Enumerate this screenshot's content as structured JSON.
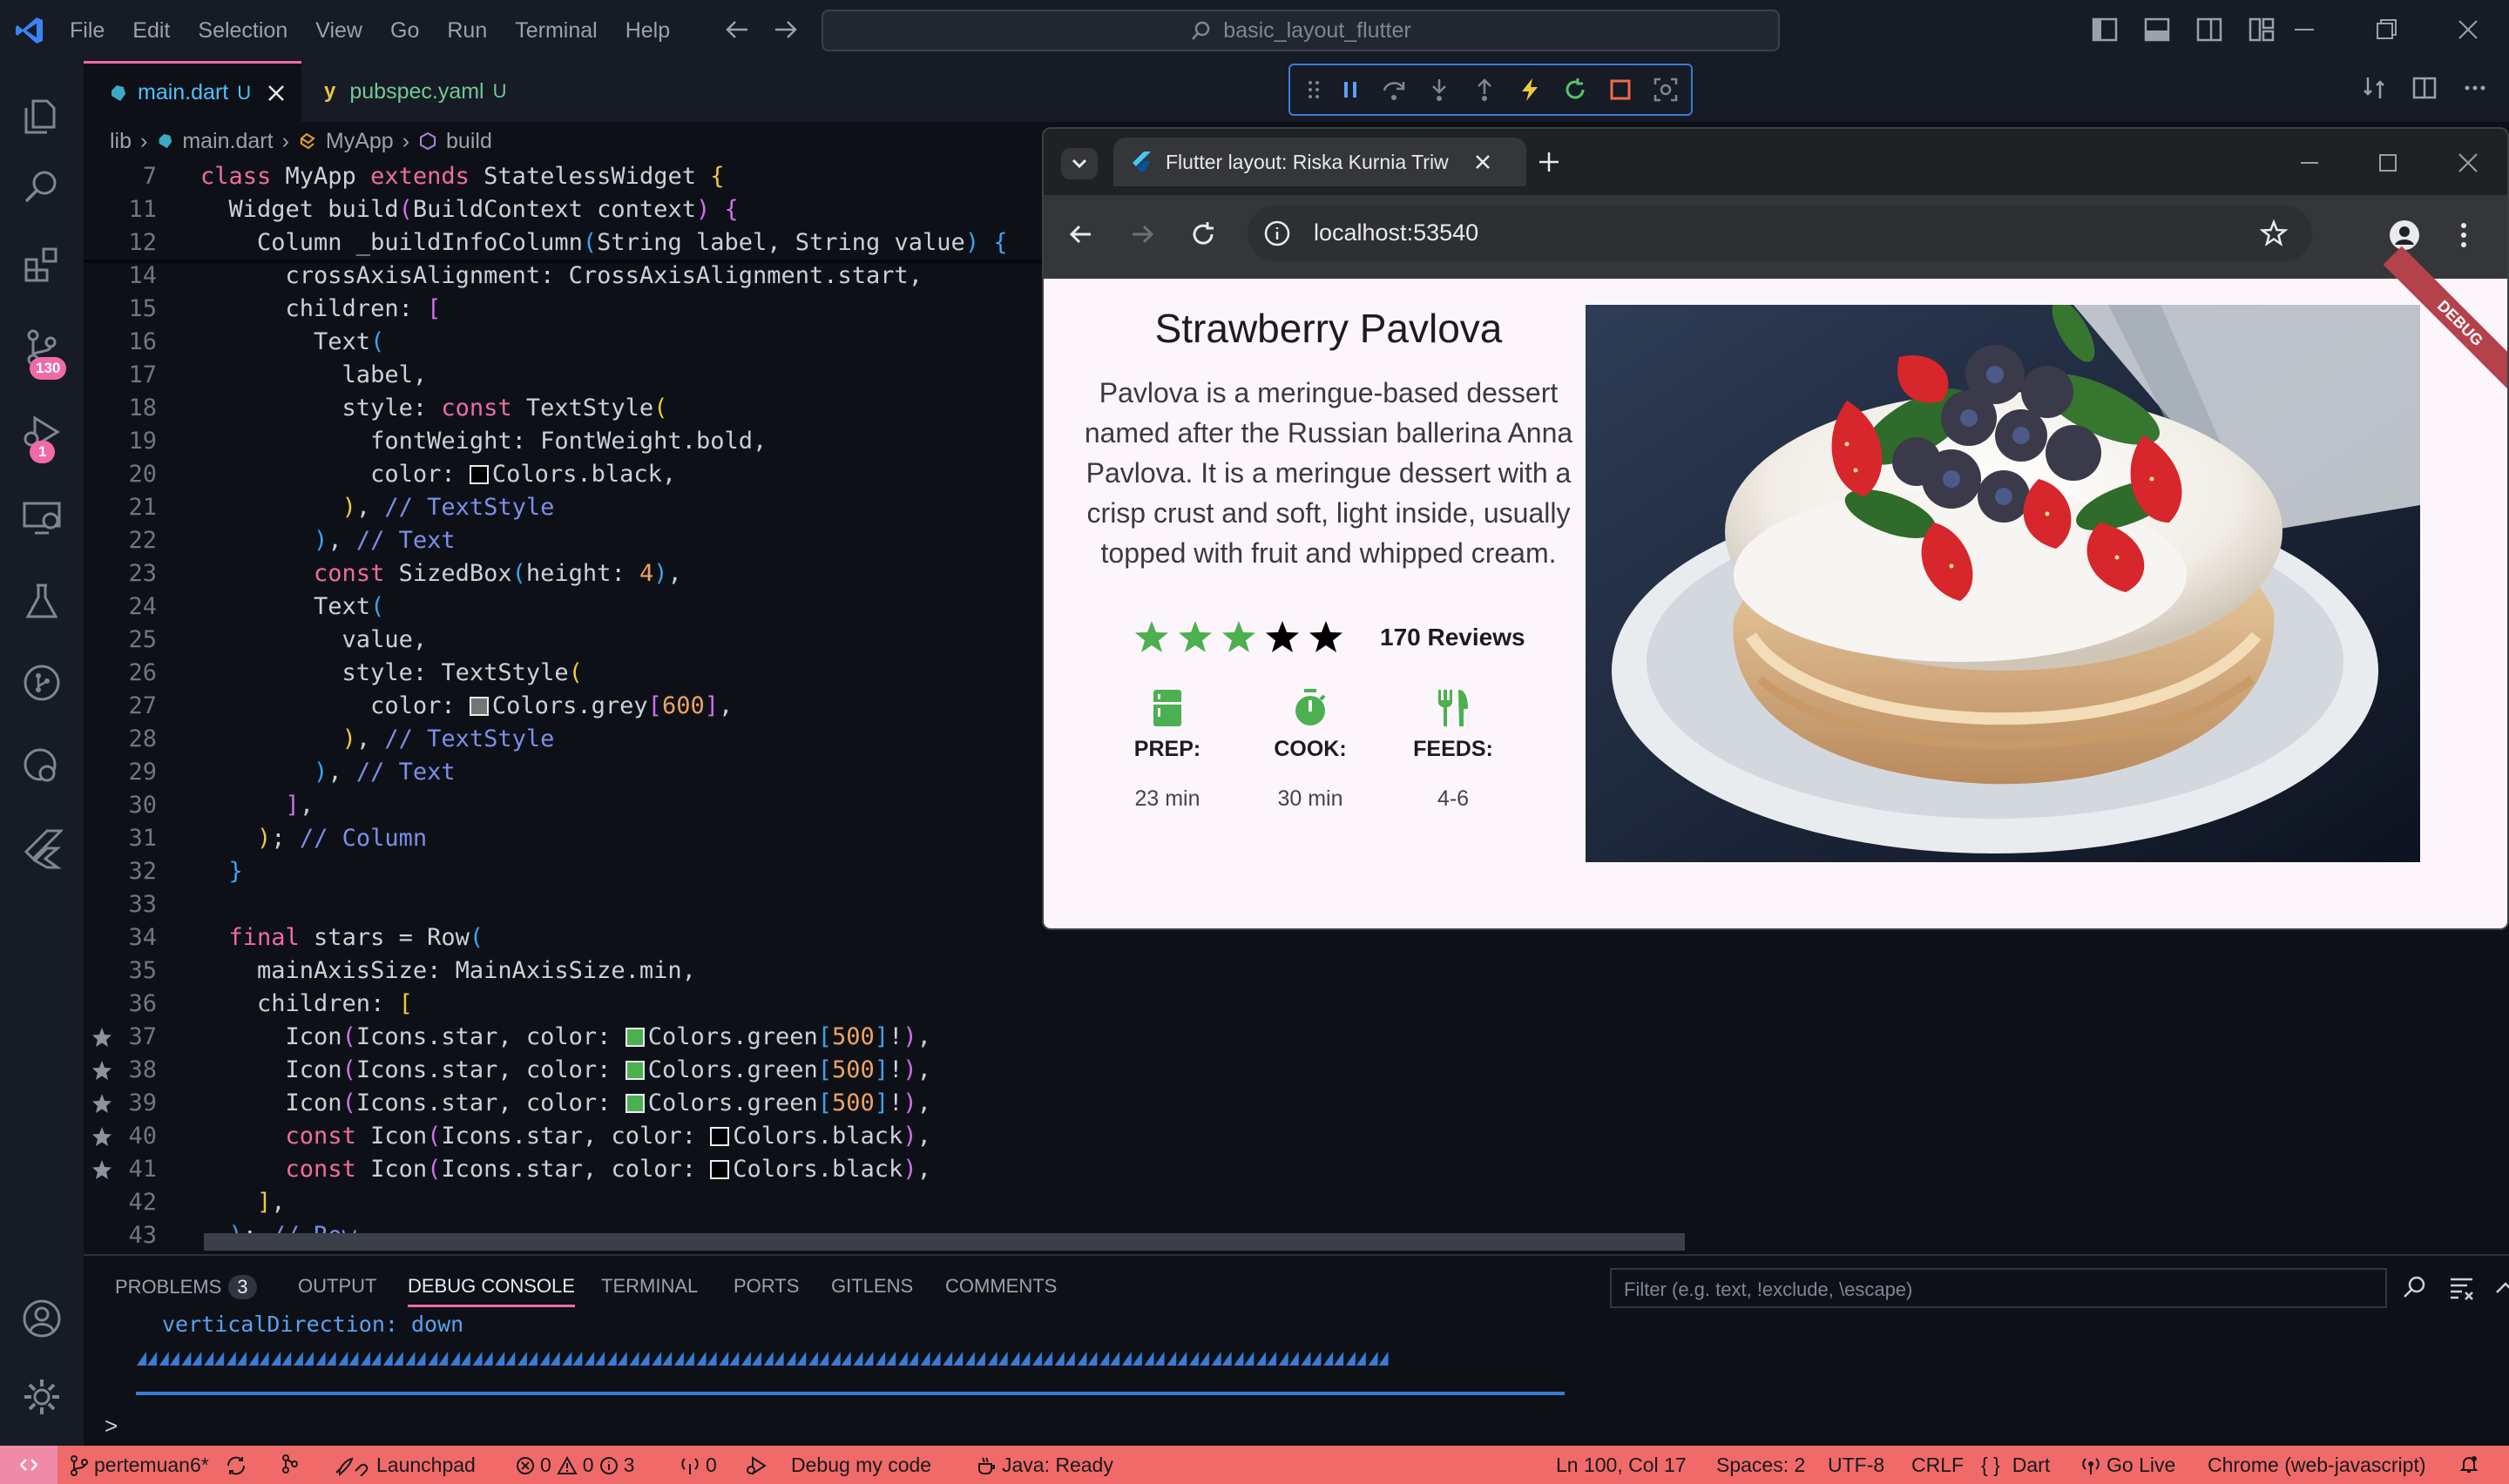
{
  "titlebar": {
    "menu": [
      "File",
      "Edit",
      "Selection",
      "View",
      "Go",
      "Run",
      "Terminal",
      "Help"
    ],
    "search_text": "basic_layout_flutter"
  },
  "activity": {
    "badges": {
      "scm": "130",
      "debug": "1"
    }
  },
  "tabs": [
    {
      "label": "main.dart",
      "status": "U",
      "active": true
    },
    {
      "label": "pubspec.yaml",
      "status": "U",
      "active": false
    }
  ],
  "breadcrumb": [
    "lib",
    "main.dart",
    "MyApp",
    "build"
  ],
  "editor": {
    "lines": [
      {
        "n": "7",
        "html": "<span class='kw'>class</span> MyApp <span class='kw'>extends</span> StatelessWidget <span class='br1'>{</span>"
      },
      {
        "n": "11",
        "html": "  Widget build<span class='br2'>(</span>BuildContext context<span class='br2'>)</span> <span class='br2'>{</span>"
      },
      {
        "n": "12",
        "html": "    Column _buildInfoColumn<span class='br3'>(</span>String label, String value<span class='br3'>)</span> <span class='br3'>{</span>"
      },
      {
        "n": "14",
        "html": "      crossAxisAlignment: CrossAxisAlignment.start,"
      },
      {
        "n": "15",
        "html": "      children: <span class='br2'>[</span>"
      },
      {
        "n": "16",
        "html": "        Text<span class='br3'>(</span>"
      },
      {
        "n": "17",
        "html": "          label,"
      },
      {
        "n": "18",
        "html": "          style: <span class='kw'>const</span> TextStyle<span class='br1'>(</span>"
      },
      {
        "n": "19",
        "html": "            fontWeight: FontWeight.bold,"
      },
      {
        "n": "20",
        "html": "            color: <span class='swatch' style='background:#000'></span>Colors.black,"
      },
      {
        "n": "21",
        "html": "          <span class='br1'>)</span>, <span class='cm'>// TextStyle</span>"
      },
      {
        "n": "22",
        "html": "        <span class='br3'>)</span>, <span class='cm'>// Text</span>"
      },
      {
        "n": "23",
        "html": "        <span class='kw'>const</span> SizedBox<span class='br3'>(</span>height: <span class='num'>4</span><span class='br3'>)</span>,"
      },
      {
        "n": "24",
        "html": "        Text<span class='br3'>(</span>"
      },
      {
        "n": "25",
        "html": "          value,"
      },
      {
        "n": "26",
        "html": "          style: TextStyle<span class='br1'>(</span>"
      },
      {
        "n": "27",
        "html": "            color: <span class='swatch' style='background:#757575'></span>Colors.grey<span class='br2'>[</span><span class='num'>600</span><span class='br2'>]</span>,"
      },
      {
        "n": "28",
        "html": "          <span class='br1'>)</span>, <span class='cm'>// TextStyle</span>"
      },
      {
        "n": "29",
        "html": "        <span class='br3'>)</span>, <span class='cm'>// Text</span>"
      },
      {
        "n": "30",
        "html": "      <span class='br2'>]</span>,"
      },
      {
        "n": "31",
        "html": "    <span class='br1'>)</span>; <span class='cm'>// Column</span>"
      },
      {
        "n": "32",
        "html": "  <span class='br3'>}</span>"
      },
      {
        "n": "33",
        "html": ""
      },
      {
        "n": "34",
        "html": "  <span class='kw'>final</span> stars = Row<span class='br3'>(</span>"
      },
      {
        "n": "35",
        "html": "    mainAxisSize: MainAxisSize.min,"
      },
      {
        "n": "36",
        "html": "    children: <span class='br1'>[</span>"
      },
      {
        "n": "37",
        "html": "      Icon<span class='br2'>(</span>Icons.star, color: <span class='swatch' style='background:#4caf50'></span>Colors.green<span class='br3'>[</span><span class='num'>500</span><span class='br3'>]</span>!<span class='br2'>)</span>,"
      },
      {
        "n": "38",
        "html": "      Icon<span class='br2'>(</span>Icons.star, color: <span class='swatch' style='background:#4caf50'></span>Colors.green<span class='br3'>[</span><span class='num'>500</span><span class='br3'>]</span>!<span class='br2'>)</span>,"
      },
      {
        "n": "39",
        "html": "      Icon<span class='br2'>(</span>Icons.star, color: <span class='swatch' style='background:#4caf50'></span>Colors.green<span class='br3'>[</span><span class='num'>500</span><span class='br3'>]</span>!<span class='br2'>)</span>,"
      },
      {
        "n": "40",
        "html": "      <span class='kw'>const</span> Icon<span class='br2'>(</span>Icons.star, color: <span class='swatch' style='background:#000'></span>Colors.black<span class='br2'>)</span>,"
      },
      {
        "n": "41",
        "html": "      <span class='kw'>const</span> Icon<span class='br2'>(</span>Icons.star, color: <span class='swatch' style='background:#000'></span>Colors.black<span class='br2'>)</span>,"
      },
      {
        "n": "42",
        "html": "    <span class='br1'>]</span>,"
      },
      {
        "n": "43",
        "html": "  <span class='br3'>)</span>; <span class='cm'>// Row</span>"
      }
    ],
    "starred_lines": [
      "37",
      "38",
      "39",
      "40",
      "41"
    ]
  },
  "panel": {
    "tabs": [
      "PROBLEMS",
      "OUTPUT",
      "DEBUG CONSOLE",
      "TERMINAL",
      "PORTS",
      "GITLENS",
      "COMMENTS"
    ],
    "problems_count": "3",
    "active_tab": "DEBUG CONSOLE",
    "console_text": "verticalDirection: down",
    "filter_placeholder": "Filter (e.g. text, !exclude, \\escape)",
    "prompt": ">"
  },
  "statusbar": {
    "branch": "pertemuan6*",
    "launchpad": "Launchpad",
    "errors": "0",
    "warnings": "0",
    "infos": "3",
    "ports": "0",
    "debug": "Debug my code",
    "java": "Java: Ready",
    "position": "Ln 100, Col 17",
    "spaces": "Spaces: 2",
    "encoding": "UTF-8",
    "eol": "CRLF",
    "language": "Dart",
    "golive": "Go Live",
    "device": "Chrome (web-javascript)"
  },
  "browser": {
    "tab_title": "Flutter layout: Riska Kurnia Triw",
    "url": "localhost:53540",
    "debug_banner": "DEBUG"
  },
  "recipe": {
    "title": "Strawberry Pavlova",
    "description": "Pavlova is a meringue-based dessert named after the Russian ballerina Anna Pavlova. It is a meringue dessert with a crisp crust and soft, light inside, usually topped with fruit and whipped cream.",
    "rating_green": 3,
    "rating_black": 2,
    "reviews": "170 Reviews",
    "info": [
      {
        "label": "PREP:",
        "value": "23 min",
        "icon": "kitchen-icon"
      },
      {
        "label": "COOK:",
        "value": "30 min",
        "icon": "timer-icon"
      },
      {
        "label": "FEEDS:",
        "value": "4-6",
        "icon": "restaurant-icon"
      }
    ]
  }
}
